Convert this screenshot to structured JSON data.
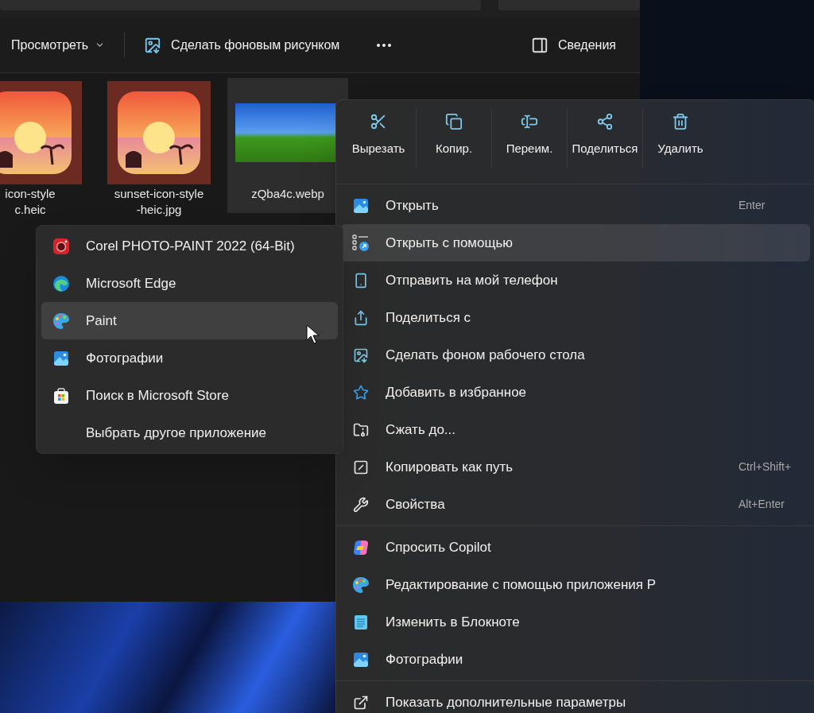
{
  "window": {
    "toolbar": {
      "view_button": {
        "label": "Просмотреть"
      },
      "wallpaper_button": {
        "label": "Сделать фоновым рисунком"
      },
      "details_button": {
        "label": "Сведения"
      }
    },
    "files": [
      {
        "kind": "art",
        "name_lines": [
          "icon-style",
          "c.heic"
        ],
        "selected": false
      },
      {
        "kind": "art",
        "name_lines": [
          "sunset-icon-style",
          "-heic.jpg"
        ],
        "selected": false
      },
      {
        "kind": "photo",
        "name_lines": [
          "zQba4c.webp"
        ],
        "selected": true
      }
    ]
  },
  "context_menu": {
    "quick_actions": [
      {
        "label": "Вырезать"
      },
      {
        "label": "Копир."
      },
      {
        "label": "Переим."
      },
      {
        "label": "Поделиться"
      },
      {
        "label": "Удалить"
      }
    ],
    "sections": [
      {
        "items": [
          {
            "label": "Открыть",
            "shortcut": "Enter",
            "selected": false
          },
          {
            "label": "Открыть с помощью",
            "selected": true
          },
          {
            "label": "Отправить на мой телефон",
            "selected": false
          },
          {
            "label": "Поделиться с",
            "selected": false
          },
          {
            "label": "Сделать фоном рабочего стола",
            "selected": false
          },
          {
            "label": "Добавить в избранное",
            "selected": false
          },
          {
            "label": "Сжать до...",
            "selected": false
          },
          {
            "label": "Копировать как путь",
            "shortcut": "Ctrl+Shift+",
            "selected": false
          },
          {
            "label": "Свойства",
            "shortcut": "Alt+Enter",
            "selected": false
          }
        ]
      },
      {
        "items": [
          {
            "label": "Спросить Copilot",
            "selected": false
          },
          {
            "label": "Редактирование с помощью приложения P",
            "selected": false
          },
          {
            "label": "Изменить в Блокноте",
            "selected": false
          },
          {
            "label": "Фотографии",
            "selected": false
          }
        ]
      },
      {
        "items": [
          {
            "label": "Показать дополнительные параметры",
            "selected": false
          }
        ]
      }
    ]
  },
  "open_with_menu": {
    "items": [
      {
        "label": "Corel PHOTO-PAINT 2022 (64-Bit)",
        "selected": false
      },
      {
        "label": "Microsoft Edge",
        "selected": false
      },
      {
        "label": "Paint",
        "selected": true
      },
      {
        "label": "Фотографии",
        "selected": false
      },
      {
        "label": "Поиск в Microsoft Store",
        "selected": false
      },
      {
        "label": "Выбрать другое приложение",
        "selected": false
      }
    ]
  }
}
